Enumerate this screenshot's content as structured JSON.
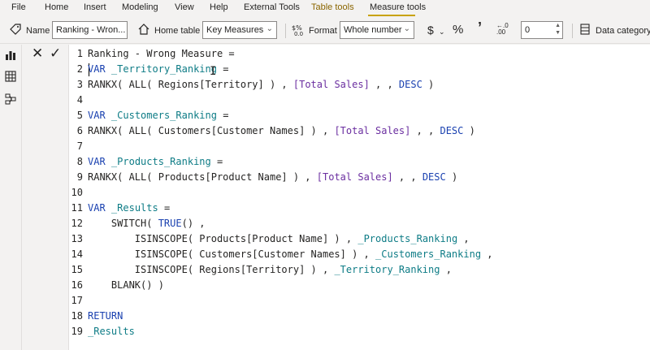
{
  "menu": {
    "file": "File",
    "home": "Home",
    "insert": "Insert",
    "modeling": "Modeling",
    "view": "View",
    "help": "Help",
    "external_tools": "External Tools",
    "table_tools": "Table tools",
    "measure_tools": "Measure tools"
  },
  "ribbon": {
    "name_label": "Name",
    "name_value": "Ranking - Wron...",
    "home_table_label": "Home table",
    "home_table_value": "Key Measures",
    "format_label": "Format",
    "format_value": "Whole number",
    "currency_symbol": "$",
    "percent_symbol": "%",
    "comma_symbol": "’",
    "decimal_places_value": "0",
    "data_category_label": "Data category"
  },
  "colors": {
    "keyword": "#1a41b0",
    "variable": "#0e7c86",
    "measure": "#6b2fa0",
    "context_tab_accent": "#c8a200"
  },
  "code": {
    "lines": [
      [
        {
          "t": "Ranking - Wrong Measure =",
          "c": "plain"
        }
      ],
      [
        {
          "t": "VAR",
          "c": "kw"
        },
        {
          "t": " ",
          "c": "plain"
        },
        {
          "t": "_Territory_Ranking",
          "c": "var"
        },
        {
          "t": " =",
          "c": "plain"
        }
      ],
      [
        {
          "t": "RANKX( ALL( Regions[Territory] ) , ",
          "c": "plain"
        },
        {
          "t": "[Total Sales]",
          "c": "meas"
        },
        {
          "t": " , , ",
          "c": "plain"
        },
        {
          "t": "DESC",
          "c": "kw"
        },
        {
          "t": " )",
          "c": "plain"
        }
      ],
      [],
      [
        {
          "t": "VAR",
          "c": "kw"
        },
        {
          "t": " ",
          "c": "plain"
        },
        {
          "t": "_Customers_Ranking",
          "c": "var"
        },
        {
          "t": " =",
          "c": "plain"
        }
      ],
      [
        {
          "t": "RANKX( ALL( Customers[Customer Names] ) , ",
          "c": "plain"
        },
        {
          "t": "[Total Sales]",
          "c": "meas"
        },
        {
          "t": " , , ",
          "c": "plain"
        },
        {
          "t": "DESC",
          "c": "kw"
        },
        {
          "t": " )",
          "c": "plain"
        }
      ],
      [],
      [
        {
          "t": "VAR",
          "c": "kw"
        },
        {
          "t": " ",
          "c": "plain"
        },
        {
          "t": "_Products_Ranking",
          "c": "var"
        },
        {
          "t": " =",
          "c": "plain"
        }
      ],
      [
        {
          "t": "RANKX( ALL( Products[Product Name] ) , ",
          "c": "plain"
        },
        {
          "t": "[Total Sales]",
          "c": "meas"
        },
        {
          "t": " , , ",
          "c": "plain"
        },
        {
          "t": "DESC",
          "c": "kw"
        },
        {
          "t": " )",
          "c": "plain"
        }
      ],
      [],
      [
        {
          "t": "VAR",
          "c": "kw"
        },
        {
          "t": " ",
          "c": "plain"
        },
        {
          "t": "_Results",
          "c": "var"
        },
        {
          "t": " =",
          "c": "plain"
        }
      ],
      [
        {
          "t": "    SWITCH( ",
          "c": "plain"
        },
        {
          "t": "TRUE",
          "c": "kw"
        },
        {
          "t": "() ,",
          "c": "plain"
        }
      ],
      [
        {
          "t": "        ISINSCOPE( Products[Product Name] ) , ",
          "c": "plain"
        },
        {
          "t": "_Products_Ranking",
          "c": "var"
        },
        {
          "t": " ,",
          "c": "plain"
        }
      ],
      [
        {
          "t": "        ISINSCOPE( Customers[Customer Names] ) , ",
          "c": "plain"
        },
        {
          "t": "_Customers_Ranking",
          "c": "var"
        },
        {
          "t": " ,",
          "c": "plain"
        }
      ],
      [
        {
          "t": "        ISINSCOPE( Regions[Territory] ) , ",
          "c": "plain"
        },
        {
          "t": "_Territory_Ranking",
          "c": "var"
        },
        {
          "t": " ,",
          "c": "plain"
        }
      ],
      [
        {
          "t": "    BLANK() )",
          "c": "plain"
        }
      ],
      [],
      [
        {
          "t": "RETURN",
          "c": "kw"
        }
      ],
      [
        {
          "t": "_Results",
          "c": "var"
        }
      ]
    ]
  }
}
